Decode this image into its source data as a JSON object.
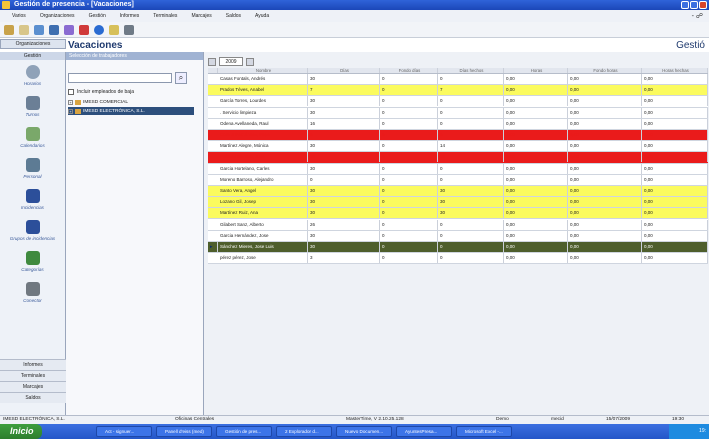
{
  "window": {
    "title": "Gestión de presencia - [Vacaciones]"
  },
  "menu": [
    "Varios",
    "Organizaciones",
    "Gestión",
    "Informes",
    "Terminales",
    "Marcajes",
    "Saldos",
    "Ayuda"
  ],
  "menu_right": "- ☍",
  "toolbar_icons": [
    "back-icon",
    "forward-icon",
    "folder-icon",
    "save-icon",
    "tag-icon",
    "erase-icon",
    "color-icon",
    "door-icon",
    "print-icon"
  ],
  "sidebar": {
    "tab": "Organizaciones",
    "header": "Gestión",
    "items": [
      {
        "label": "Horarios",
        "icon": "clock-icon",
        "color": "#8fa2b8"
      },
      {
        "label": "Turnos",
        "icon": "turns-icon",
        "color": "#6b7f96"
      },
      {
        "label": "Calendarios",
        "icon": "calendar-icon",
        "color": "#7aa86a"
      },
      {
        "label": "Personal",
        "icon": "person-icon",
        "color": "#5d7b94"
      },
      {
        "label": "Incidencias",
        "icon": "incident-icon",
        "color": "#2c4f9a"
      },
      {
        "label": "Grupos de incidencias",
        "icon": "group-icon",
        "color": "#2c4f9a"
      },
      {
        "label": "Categorías",
        "icon": "category-icon",
        "color": "#3f8a3f"
      },
      {
        "label": "Conector",
        "icon": "connector-icon",
        "color": "#707880"
      }
    ],
    "bottom": [
      "Informes",
      "Terminales",
      "Marcajes",
      "Saldos"
    ]
  },
  "page": {
    "title": "Vacaciones",
    "right_title": "Gestió"
  },
  "panel": {
    "header": "Selección de trabajadores",
    "checkbox_label": "Incluir empleados de baja",
    "tree": [
      {
        "label": "IMESD COMERCIAL",
        "selected": false
      },
      {
        "label": "IMESD ELECTRÓNICA, S.L.",
        "selected": true
      }
    ]
  },
  "year": "2009",
  "grid": {
    "headers": [
      "",
      "Nombre",
      "Días",
      "Fondo días",
      "Días hechos",
      "Horas",
      "Fondo horas",
      "Horas hechas"
    ],
    "rows": [
      {
        "style": "white",
        "cells": [
          "",
          "Casas Fontals, Andrés",
          "30",
          "0",
          "0",
          "0,00",
          "0,00",
          "0,00"
        ]
      },
      {
        "style": "yellow",
        "cells": [
          "",
          "Prados Téves, Anabel",
          "7",
          "0",
          "7",
          "0,00",
          "0,00",
          "0,00"
        ]
      },
      {
        "style": "white",
        "cells": [
          "",
          "García Torres, Lourdes",
          "30",
          "0",
          "0",
          "0,00",
          "0,00",
          "0,00"
        ]
      },
      {
        "style": "white",
        "cells": [
          "",
          ". Servicio limpieza",
          "30",
          "0",
          "0",
          "0,00",
          "0,00",
          "0,00"
        ]
      },
      {
        "style": "white",
        "cells": [
          "",
          "Odena Avellaneda, Raul",
          "16",
          "0",
          "0",
          "0,00",
          "0,00",
          "0,00"
        ]
      },
      {
        "style": "red",
        "cells": [
          "",
          "Corella Fernández, Pepe",
          "0",
          "0",
          "0",
          "0,00",
          "0,00",
          "0,00"
        ]
      },
      {
        "style": "white",
        "cells": [
          "",
          "Martínez Alegre, Mónica",
          "30",
          "0",
          "14",
          "0,00",
          "0,00",
          "0,00"
        ]
      },
      {
        "style": "red",
        "cells": [
          "",
          "Pallares Herrero, Jose",
          "30",
          "0",
          "30",
          "0,00",
          "0,00",
          "0,00"
        ]
      },
      {
        "style": "white",
        "cells": [
          "",
          "Garcia Hortelano, Carles",
          "30",
          "0",
          "0",
          "0,00",
          "0,00",
          "0,00"
        ]
      },
      {
        "style": "white",
        "cells": [
          "",
          "Moreno Barroso, Alejandro",
          "0",
          "0",
          "0",
          "0,00",
          "0,00",
          "0,00"
        ]
      },
      {
        "style": "yellow",
        "cells": [
          "",
          "Santo Vera, Angel",
          "30",
          "0",
          "30",
          "0,00",
          "0,00",
          "0,00"
        ]
      },
      {
        "style": "yellow",
        "cells": [
          "",
          "Lozano Gil, Josep",
          "30",
          "0",
          "30",
          "0,00",
          "0,00",
          "0,00"
        ]
      },
      {
        "style": "yellow",
        "cells": [
          "",
          "Martínez Ruiz, Ana",
          "30",
          "0",
          "30",
          "0,00",
          "0,00",
          "0,00"
        ]
      },
      {
        "style": "white",
        "cells": [
          "",
          "Gilabert Sanz, Alberto",
          "26",
          "0",
          "0",
          "0,00",
          "0,00",
          "0,00"
        ]
      },
      {
        "style": "white",
        "cells": [
          "",
          "Garcia Hernández, Jose",
          "30",
          "0",
          "0",
          "0,00",
          "0,00",
          "0,00"
        ]
      },
      {
        "style": "dark",
        "cells": [
          "▸",
          "Sánchez Mieres, Jose Luis",
          "30",
          "0",
          "0",
          "0,00",
          "0,00",
          "0,00"
        ]
      },
      {
        "style": "white",
        "cells": [
          "",
          "pérez pérez, Jose",
          "3",
          "0",
          "0",
          "0,00",
          "0,00",
          "0,00"
        ]
      }
    ]
  },
  "status": {
    "company": "IMESD ELECTRÓNICA, S.L.",
    "office": "Oficinas Centrales",
    "version": "MasterTime, V 2.10.25.128",
    "user": "Demo",
    "mode": "mecid",
    "date": "15/07/2009",
    "time": "19:30"
  },
  "taskbar": {
    "start": "Inicio",
    "tasks": [
      "Act - signuer...",
      "Panell d'eiss (med)",
      "Gestión de pres...",
      "2 Explorador d...",
      "Nuevo Documen...",
      "AyuntesPresa...",
      "Microsoft Excel -..."
    ],
    "clock": "19:"
  }
}
